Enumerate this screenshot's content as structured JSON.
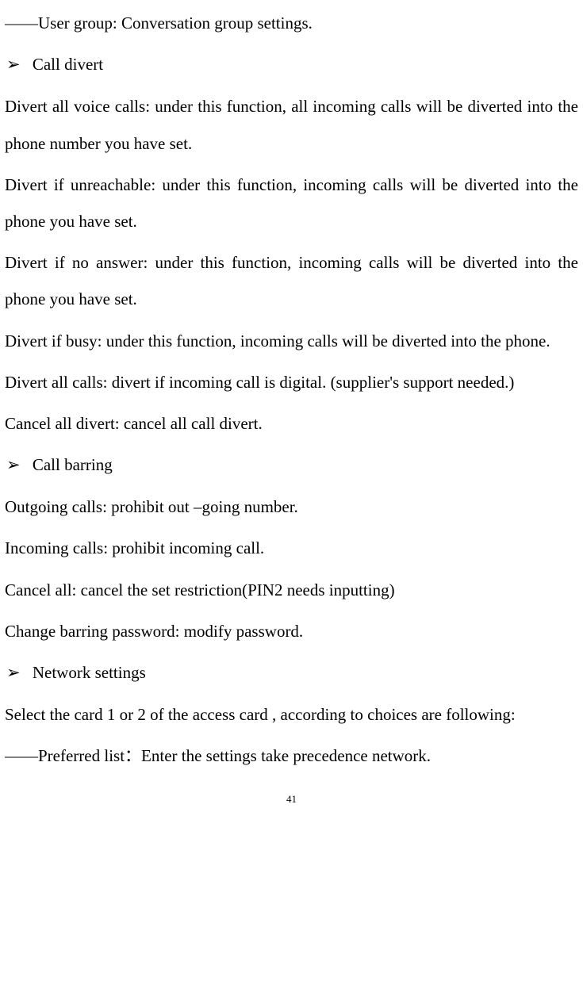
{
  "line0": "——User group: Conversation group settings.",
  "bullet_marker": "➢",
  "bullet1": "Call divert",
  "p1": "Divert all voice calls: under this function, all incoming calls will be diverted into the phone number you have set.",
  "p2": "Divert if unreachable: under this function, incoming calls will be diverted into the phone you have set.",
  "p3": "Divert if no answer: under this function, incoming calls will be diverted into the phone you have set.",
  "p4": "Divert if busy: under this function, incoming calls will be diverted into the phone.",
  "p5": "Divert all calls: divert if incoming call is digital. (supplier's support needed.)",
  "p6": "Cancel all divert: cancel all call divert.",
  "bullet2": "Call barring",
  "p7": "Outgoing calls: prohibit out –going number.",
  "p8": "Incoming calls: prohibit incoming call.",
  "p9": "Cancel all: cancel the set restriction(PIN2 needs inputting)",
  "p10": "Change barring password: modify password.",
  "bullet3": "Network settings",
  "p11": "Select the card 1 or 2 of the access card , according to choices are following:",
  "p12": "――Preferred list：Enter the settings take precedence network.",
  "page_number": "41"
}
